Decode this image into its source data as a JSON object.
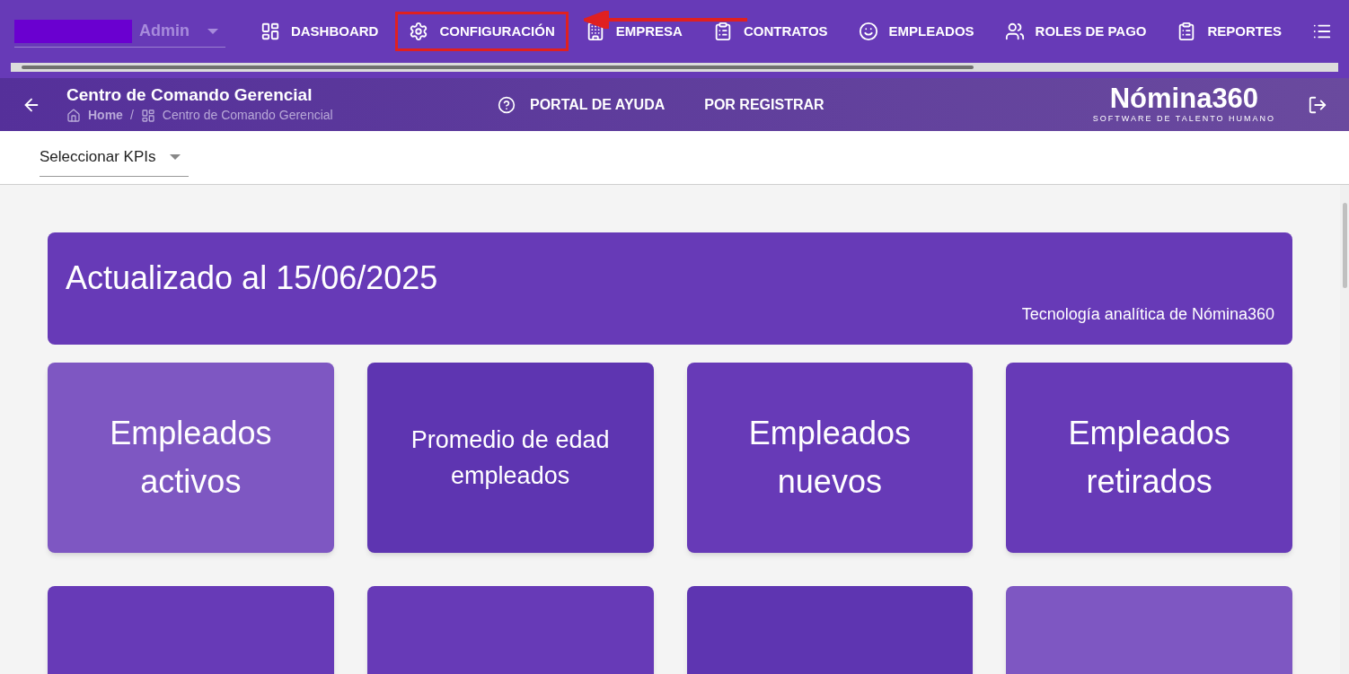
{
  "user": {
    "role": "Admin"
  },
  "nav": [
    {
      "label": "DASHBOARD",
      "kind": "dashboard",
      "highlighted": false
    },
    {
      "label": "CONFIGURACIÓN",
      "kind": "settings",
      "highlighted": true
    },
    {
      "label": "EMPRESA",
      "kind": "building",
      "highlighted": false
    },
    {
      "label": "CONTRATOS",
      "kind": "clipboard",
      "highlighted": false
    },
    {
      "label": "EMPLEADOS",
      "kind": "face",
      "highlighted": false
    },
    {
      "label": "ROLES DE PAGO",
      "kind": "users",
      "highlighted": false
    },
    {
      "label": "REPORTES",
      "kind": "clipboard",
      "highlighted": false
    },
    {
      "kind": "list",
      "highlighted": false
    }
  ],
  "header": {
    "title": "Centro de Comando Gerencial",
    "breadcrumb": [
      "Home",
      "Centro de Comando Gerencial"
    ],
    "breadcrumb_separator": "/",
    "links": [
      {
        "label": "PORTAL DE AYUDA",
        "kind": "help"
      },
      {
        "label": "POR REGISTRAR",
        "kind": "plain"
      }
    ],
    "logo": "Nómina360",
    "logo_tagline": "SOFTWARE DE TALENTO HUMANO"
  },
  "kpi_select": {
    "placeholder": "Seleccionar KPIs"
  },
  "banner": {
    "title": "Actualizado al 15/06/2025",
    "subtitle": "Tecnología analítica de Nómina360"
  },
  "cards": [
    {
      "label": "Empleados activos",
      "color": "#7e57c2",
      "kind": "large"
    },
    {
      "label": "Promedio de edad empleados",
      "color": "#5e35b1",
      "kind": "small"
    },
    {
      "label": "Empleados nuevos",
      "color": "#673ab7",
      "kind": "large"
    },
    {
      "label": "Empleados retirados",
      "color": "#673ab7",
      "kind": "large"
    },
    {
      "color": "#673ab7",
      "kind": "blank"
    },
    {
      "color": "#673ab7",
      "kind": "blank"
    },
    {
      "color": "#5e35b1",
      "kind": "blank"
    },
    {
      "color": "#7e57c2",
      "kind": "blank"
    }
  ]
}
